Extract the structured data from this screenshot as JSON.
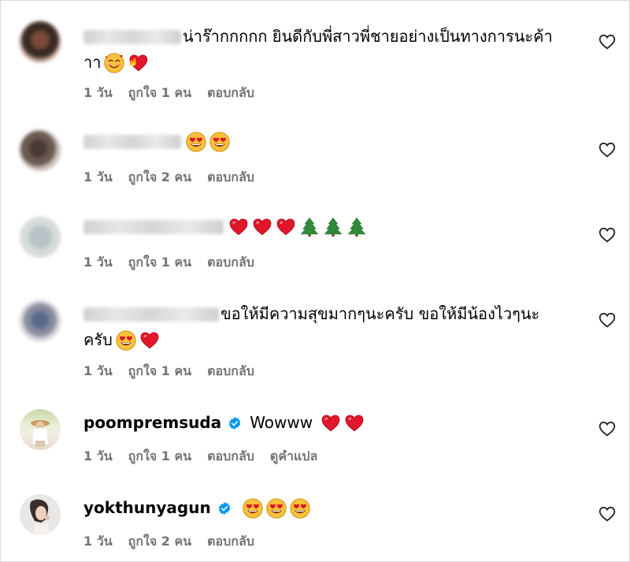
{
  "colors": {
    "meta_text": "#737373",
    "verified": "#0095f6",
    "heart_red": "#e0162b",
    "tree_green": "#2e8b3a",
    "border": "#dbdbdb"
  },
  "comments": [
    {
      "username": "",
      "username_blurred": true,
      "text_line1": "น่าร๊ากกกกก ยินดีกับพี่สาวพี่ชายอย่างเป็นทางการนะค้า",
      "text_line2": "าา",
      "emojis": [
        "smiling-face-with-hearts",
        "heart-on-fire"
      ],
      "time": "1 วัน",
      "likes": "ถูกใจ 1 คน",
      "reply": "ตอบกลับ"
    },
    {
      "username": "",
      "username_blurred": true,
      "text_line1": "",
      "emojis": [
        "heart-eyes",
        "heart-eyes"
      ],
      "time": "1 วัน",
      "likes": "ถูกใจ 2 คน",
      "reply": "ตอบกลับ"
    },
    {
      "username": "",
      "username_blurred": true,
      "text_line1": "",
      "emojis": [
        "red-heart",
        "red-heart",
        "red-heart",
        "evergreen-tree",
        "evergreen-tree",
        "evergreen-tree"
      ],
      "time": "1 วัน",
      "likes": "ถูกใจ 1 คน",
      "reply": "ตอบกลับ"
    },
    {
      "username": "",
      "username_blurred": true,
      "text_line1": "ขอให้มีความสุขมากๆนะครับ ขอให้มีน้องไวๆนะ",
      "text_line2": "ครับ",
      "emojis": [
        "heart-eyes",
        "red-heart"
      ],
      "time": "1 วัน",
      "likes": "ถูกใจ 1 คน",
      "reply": "ตอบกลับ"
    },
    {
      "username": "poompremsuda",
      "verified": true,
      "text_line1": "Wowww",
      "emojis": [
        "red-heart",
        "red-heart"
      ],
      "time": "1 วัน",
      "likes": "ถูกใจ 1 คน",
      "reply": "ตอบกลับ",
      "translate": "ดูคำแปล"
    },
    {
      "username": "yokthunyagun",
      "verified": true,
      "text_line1": "",
      "emojis": [
        "heart-eyes",
        "heart-eyes",
        "heart-eyes"
      ],
      "time": "1 วัน",
      "likes": "ถูกใจ 2 คน",
      "reply": "ตอบกลับ"
    }
  ]
}
